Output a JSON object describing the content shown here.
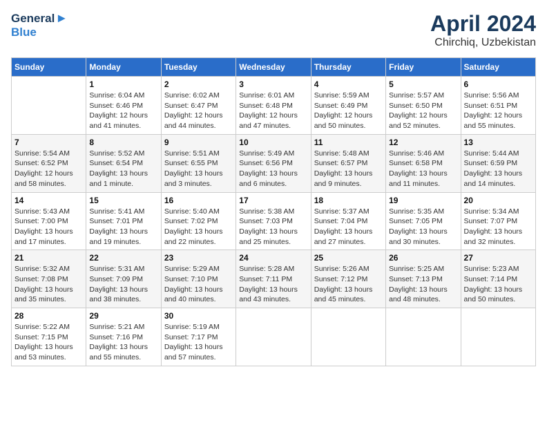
{
  "header": {
    "logo_general": "General",
    "logo_blue": "Blue",
    "title": "April 2024",
    "subtitle": "Chirchiq, Uzbekistan"
  },
  "columns": [
    "Sunday",
    "Monday",
    "Tuesday",
    "Wednesday",
    "Thursday",
    "Friday",
    "Saturday"
  ],
  "weeks": [
    [
      {
        "day": "",
        "info": ""
      },
      {
        "day": "1",
        "info": "Sunrise: 6:04 AM\nSunset: 6:46 PM\nDaylight: 12 hours\nand 41 minutes."
      },
      {
        "day": "2",
        "info": "Sunrise: 6:02 AM\nSunset: 6:47 PM\nDaylight: 12 hours\nand 44 minutes."
      },
      {
        "day": "3",
        "info": "Sunrise: 6:01 AM\nSunset: 6:48 PM\nDaylight: 12 hours\nand 47 minutes."
      },
      {
        "day": "4",
        "info": "Sunrise: 5:59 AM\nSunset: 6:49 PM\nDaylight: 12 hours\nand 50 minutes."
      },
      {
        "day": "5",
        "info": "Sunrise: 5:57 AM\nSunset: 6:50 PM\nDaylight: 12 hours\nand 52 minutes."
      },
      {
        "day": "6",
        "info": "Sunrise: 5:56 AM\nSunset: 6:51 PM\nDaylight: 12 hours\nand 55 minutes."
      }
    ],
    [
      {
        "day": "7",
        "info": "Sunrise: 5:54 AM\nSunset: 6:52 PM\nDaylight: 12 hours\nand 58 minutes."
      },
      {
        "day": "8",
        "info": "Sunrise: 5:52 AM\nSunset: 6:54 PM\nDaylight: 13 hours\nand 1 minute."
      },
      {
        "day": "9",
        "info": "Sunrise: 5:51 AM\nSunset: 6:55 PM\nDaylight: 13 hours\nand 3 minutes."
      },
      {
        "day": "10",
        "info": "Sunrise: 5:49 AM\nSunset: 6:56 PM\nDaylight: 13 hours\nand 6 minutes."
      },
      {
        "day": "11",
        "info": "Sunrise: 5:48 AM\nSunset: 6:57 PM\nDaylight: 13 hours\nand 9 minutes."
      },
      {
        "day": "12",
        "info": "Sunrise: 5:46 AM\nSunset: 6:58 PM\nDaylight: 13 hours\nand 11 minutes."
      },
      {
        "day": "13",
        "info": "Sunrise: 5:44 AM\nSunset: 6:59 PM\nDaylight: 13 hours\nand 14 minutes."
      }
    ],
    [
      {
        "day": "14",
        "info": "Sunrise: 5:43 AM\nSunset: 7:00 PM\nDaylight: 13 hours\nand 17 minutes."
      },
      {
        "day": "15",
        "info": "Sunrise: 5:41 AM\nSunset: 7:01 PM\nDaylight: 13 hours\nand 19 minutes."
      },
      {
        "day": "16",
        "info": "Sunrise: 5:40 AM\nSunset: 7:02 PM\nDaylight: 13 hours\nand 22 minutes."
      },
      {
        "day": "17",
        "info": "Sunrise: 5:38 AM\nSunset: 7:03 PM\nDaylight: 13 hours\nand 25 minutes."
      },
      {
        "day": "18",
        "info": "Sunrise: 5:37 AM\nSunset: 7:04 PM\nDaylight: 13 hours\nand 27 minutes."
      },
      {
        "day": "19",
        "info": "Sunrise: 5:35 AM\nSunset: 7:05 PM\nDaylight: 13 hours\nand 30 minutes."
      },
      {
        "day": "20",
        "info": "Sunrise: 5:34 AM\nSunset: 7:07 PM\nDaylight: 13 hours\nand 32 minutes."
      }
    ],
    [
      {
        "day": "21",
        "info": "Sunrise: 5:32 AM\nSunset: 7:08 PM\nDaylight: 13 hours\nand 35 minutes."
      },
      {
        "day": "22",
        "info": "Sunrise: 5:31 AM\nSunset: 7:09 PM\nDaylight: 13 hours\nand 38 minutes."
      },
      {
        "day": "23",
        "info": "Sunrise: 5:29 AM\nSunset: 7:10 PM\nDaylight: 13 hours\nand 40 minutes."
      },
      {
        "day": "24",
        "info": "Sunrise: 5:28 AM\nSunset: 7:11 PM\nDaylight: 13 hours\nand 43 minutes."
      },
      {
        "day": "25",
        "info": "Sunrise: 5:26 AM\nSunset: 7:12 PM\nDaylight: 13 hours\nand 45 minutes."
      },
      {
        "day": "26",
        "info": "Sunrise: 5:25 AM\nSunset: 7:13 PM\nDaylight: 13 hours\nand 48 minutes."
      },
      {
        "day": "27",
        "info": "Sunrise: 5:23 AM\nSunset: 7:14 PM\nDaylight: 13 hours\nand 50 minutes."
      }
    ],
    [
      {
        "day": "28",
        "info": "Sunrise: 5:22 AM\nSunset: 7:15 PM\nDaylight: 13 hours\nand 53 minutes."
      },
      {
        "day": "29",
        "info": "Sunrise: 5:21 AM\nSunset: 7:16 PM\nDaylight: 13 hours\nand 55 minutes."
      },
      {
        "day": "30",
        "info": "Sunrise: 5:19 AM\nSunset: 7:17 PM\nDaylight: 13 hours\nand 57 minutes."
      },
      {
        "day": "",
        "info": ""
      },
      {
        "day": "",
        "info": ""
      },
      {
        "day": "",
        "info": ""
      },
      {
        "day": "",
        "info": ""
      }
    ]
  ]
}
